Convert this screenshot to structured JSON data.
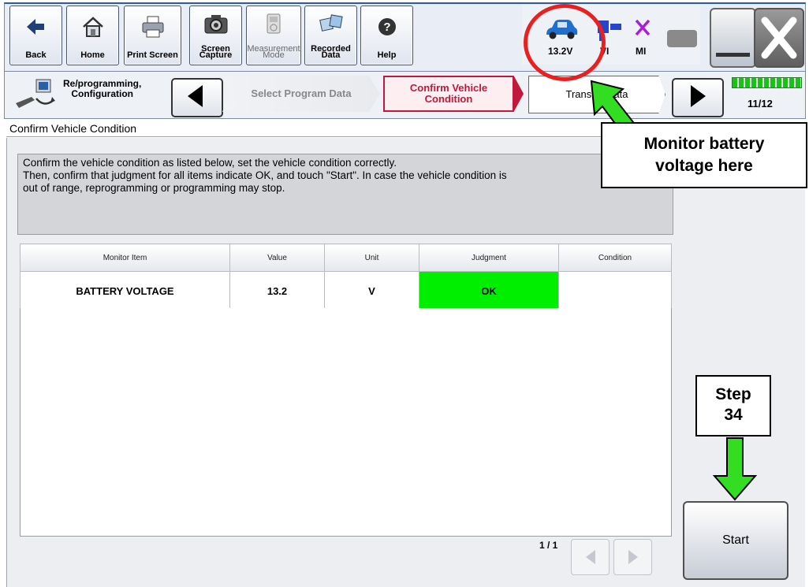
{
  "toolbar": {
    "back": "Back",
    "home": "Home",
    "print_screen": "Print Screen",
    "screen_capture_1": "Screen",
    "screen_capture_2": "Capture",
    "measurement_1": "Measurement",
    "measurement_2": "Mode",
    "recorded_1": "Recorded",
    "recorded_2": "Data",
    "help": "Help"
  },
  "status": {
    "battery_voltage": "13.2V",
    "vi_label": "VI",
    "mi_label": "MI"
  },
  "steps": {
    "section_1": "Re/programming,",
    "section_2": "Configuration",
    "prev_step": "Select Program Data",
    "current_1": "Confirm Vehicle",
    "current_2": "Condition",
    "next_step": "Transfer Data",
    "page_counter": "11/12"
  },
  "page": {
    "title": "Confirm Vehicle Condition",
    "instruction_1": "Confirm the vehicle condition as listed below, set the vehicle condition correctly.",
    "instruction_2": "Then, confirm that judgment for all items indicate OK, and touch \"Start\". In case the vehicle condition is",
    "instruction_3": "out of range, reprogramming or programming may stop."
  },
  "table": {
    "headers": [
      "Monitor Item",
      "Value",
      "Unit",
      "Judgment",
      "Condition"
    ],
    "rows": [
      {
        "item": "BATTERY VOLTAGE",
        "value": "13.2",
        "unit": "V",
        "judgment": "OK",
        "condition": ""
      }
    ]
  },
  "pager": {
    "label": "1 / 1"
  },
  "start_button": "Start",
  "annotations": {
    "monitor_1": "Monitor battery",
    "monitor_2": "voltage here",
    "step_1": "Step",
    "step_2": "34"
  },
  "colors": {
    "ok_green": "#00ef00",
    "arrow_green": "#33dd22",
    "highlight_red": "#e8201f",
    "current_step_border": "#c2183b"
  }
}
